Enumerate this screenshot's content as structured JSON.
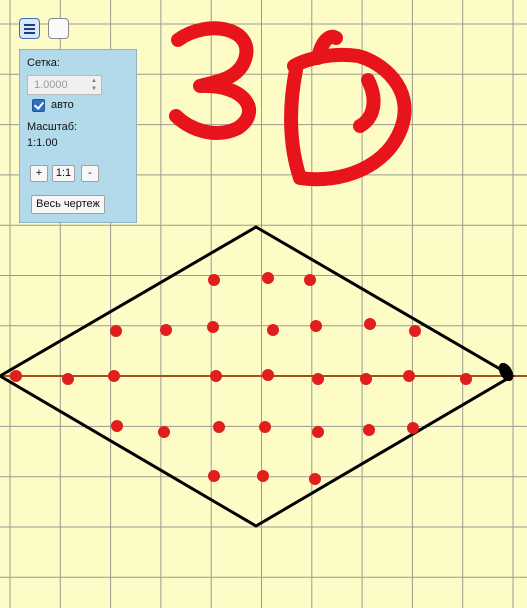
{
  "toolbar": {
    "menu_icon": "hamburger-menu-icon",
    "blank_icon": "empty-square"
  },
  "panel": {
    "grid_label": "Сетка:",
    "grid_value": "1.0000",
    "auto_label": "авто",
    "auto_checked": true,
    "scale_label": "Масштаб:",
    "scale_value": "1:1.00",
    "zoom_in_label": "+",
    "zoom_reset_label": "1:1",
    "zoom_out_label": "-",
    "fit_all_label": "Весь чертеж"
  },
  "drawing": {
    "handwritten_text": "3D",
    "colors": {
      "background": "#fdfcc6",
      "grid": "#9a9a92",
      "axis": "#a0521b",
      "outline": "#000000",
      "points": "#e01e1e",
      "handwriting": "#e8141c"
    }
  }
}
